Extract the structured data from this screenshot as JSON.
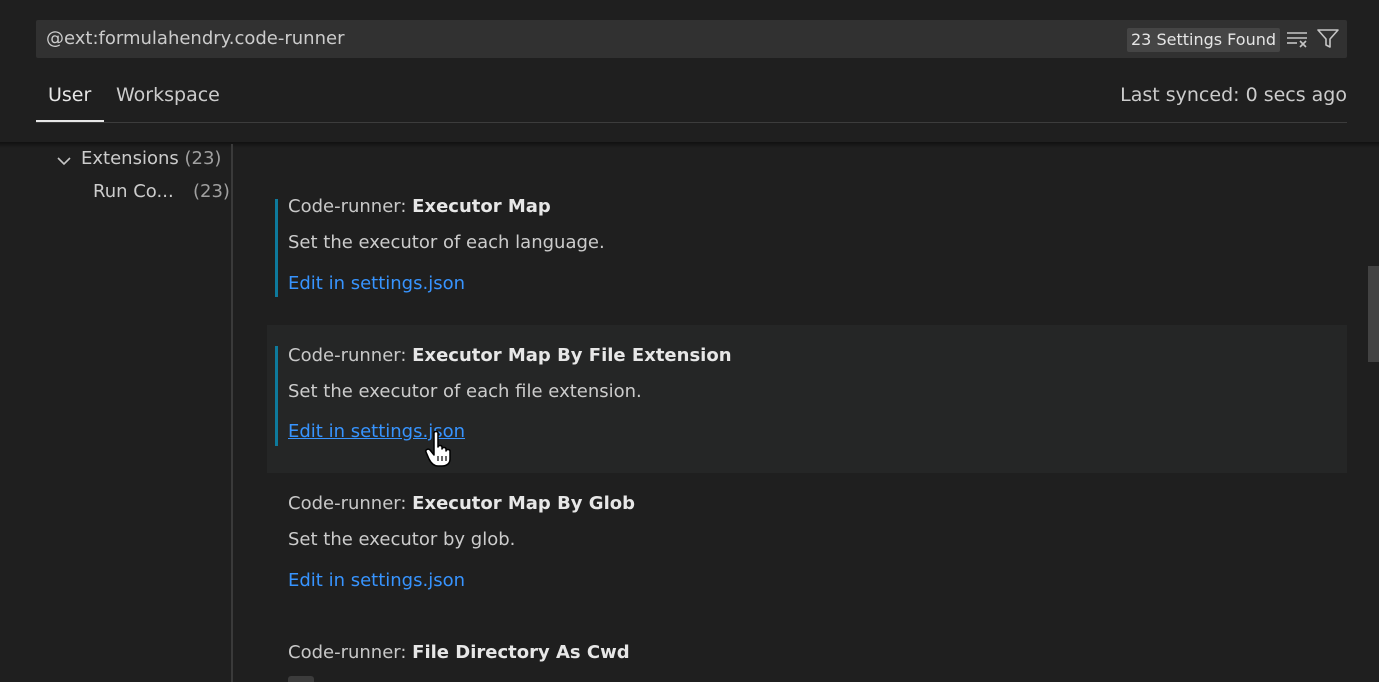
{
  "search": {
    "value": "@ext:formulahendry.code-runner",
    "result_count": "23 Settings Found",
    "clear_icon": "clear-filter-icon",
    "filter_icon": "filter-icon"
  },
  "tabs": [
    {
      "label": "User",
      "active": true
    },
    {
      "label": "Workspace",
      "active": false
    }
  ],
  "sync_status": "Last synced: 0 secs ago",
  "toc": {
    "items": [
      {
        "label": "Extensions",
        "count": "(23)",
        "expanded": true
      },
      {
        "label": "Run Co...",
        "count": "(23)"
      }
    ]
  },
  "settings": [
    {
      "category": "Code-runner: ",
      "name": "Executor Map",
      "description": "Set the executor of each language.",
      "link": "Edit in settings.json"
    },
    {
      "category": "Code-runner: ",
      "name": "Executor Map By File Extension",
      "description": "Set the executor of each file extension.",
      "link": "Edit in settings.json"
    },
    {
      "category": "Code-runner: ",
      "name": "Executor Map By Glob",
      "description": "Set the executor by glob.",
      "link": "Edit in settings.json"
    },
    {
      "category": "Code-runner: ",
      "name": "File Directory As Cwd"
    }
  ],
  "colors": {
    "background": "#1f1f1f",
    "link": "#3794ff",
    "modified_indicator": "#0e7a9c",
    "focused_row": "#252626"
  }
}
